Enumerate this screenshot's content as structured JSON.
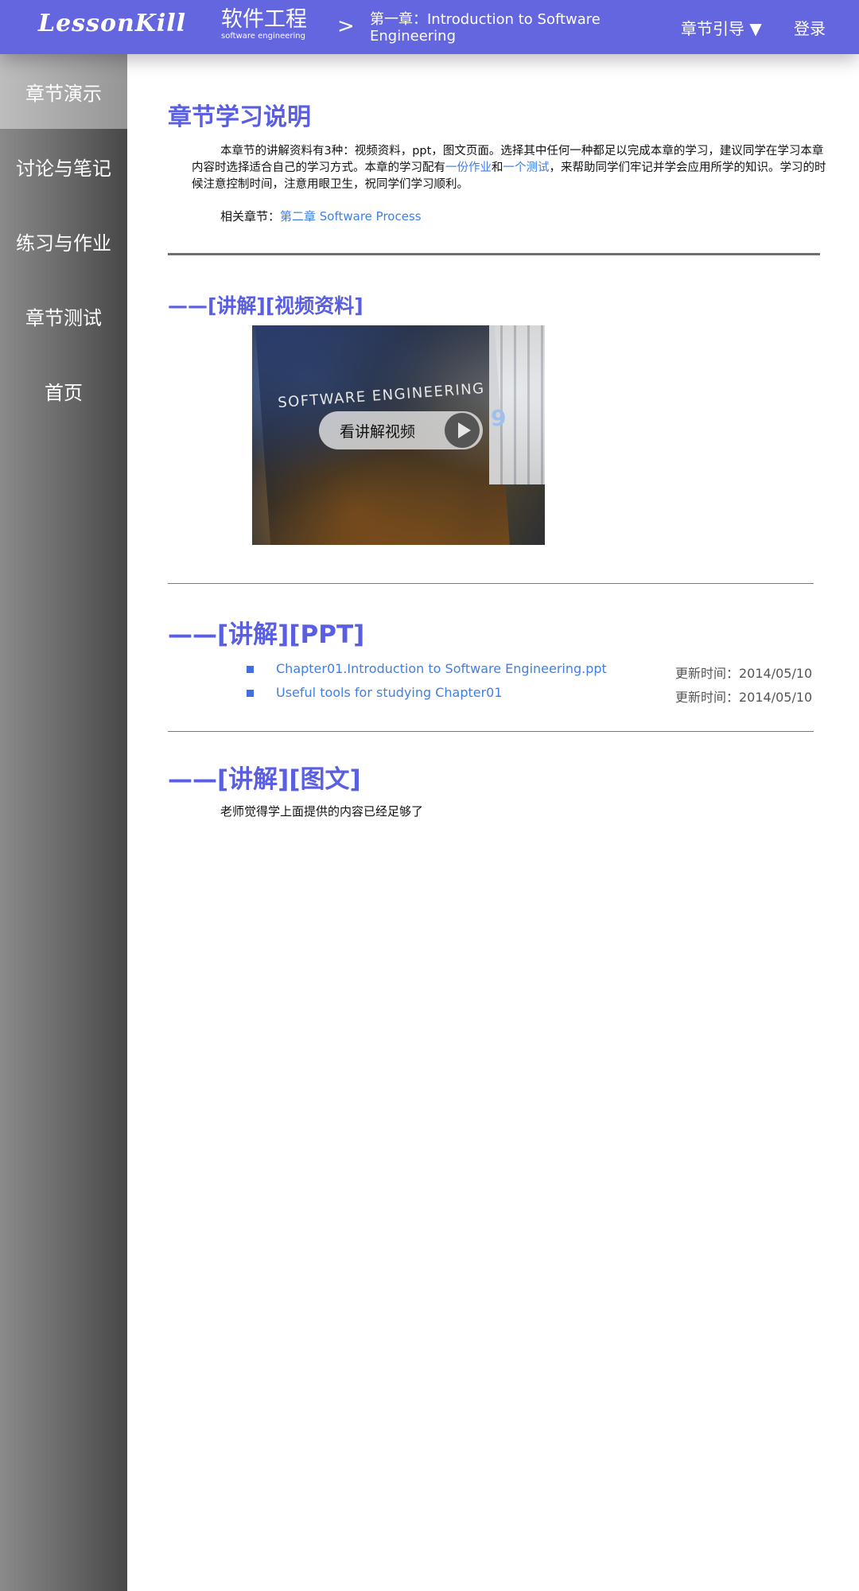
{
  "header": {
    "logo": "LessonKill",
    "course_title": "软件工程",
    "course_subtitle": "software engineering",
    "separator": ">",
    "chapter": "第一章：Introduction to Software Engineering",
    "chapter_nav": "章节引导 ▼",
    "login": "登录"
  },
  "sidebar": {
    "items": [
      {
        "label": "章节演示"
      },
      {
        "label": "讨论与笔记"
      },
      {
        "label": "练习与作业"
      },
      {
        "label": "章节测试"
      },
      {
        "label": "首页"
      }
    ]
  },
  "intro": {
    "title": "章节学习说明",
    "text_part1": "本章节的讲解资料有3种：视频资料，ppt，图文页面。选择其中任何一种都足以完成本章的学习，建议同学在学习本章内容时选择适合自己的学习方式。本章的学习配有",
    "homework_link": "一份作业",
    "text_and": "和",
    "test_link": "一个测试",
    "text_part2": "，来帮助同学们牢记并学会应用所学的知识。学习的时候注意控制时间，注意用眼卫生，祝同学们学习顺利。",
    "related_label": "相关章节：",
    "related_link": "第二章 Software Process"
  },
  "video_section": {
    "heading": "——[讲解][视频资料]",
    "book_title": "SOFTWARE ENGINEERING",
    "book_edition": "9",
    "play_label": "看讲解视频"
  },
  "ppt_section": {
    "heading": "——[讲解][PPT]",
    "files": [
      {
        "name": "Chapter01.Introduction to Software Engineering.ppt",
        "updated": "更新时间：2014/05/10"
      },
      {
        "name": "Useful tools for studying Chapter01",
        "updated": "更新时间：2014/05/10"
      }
    ]
  },
  "text_section": {
    "heading": "——[讲解][图文]",
    "note": "老师觉得学上面提供的内容已经足够了"
  },
  "colors": {
    "header_bg": "#6466e0",
    "accent_heading": "#5a5ee0",
    "link": "#3f7fe6"
  }
}
